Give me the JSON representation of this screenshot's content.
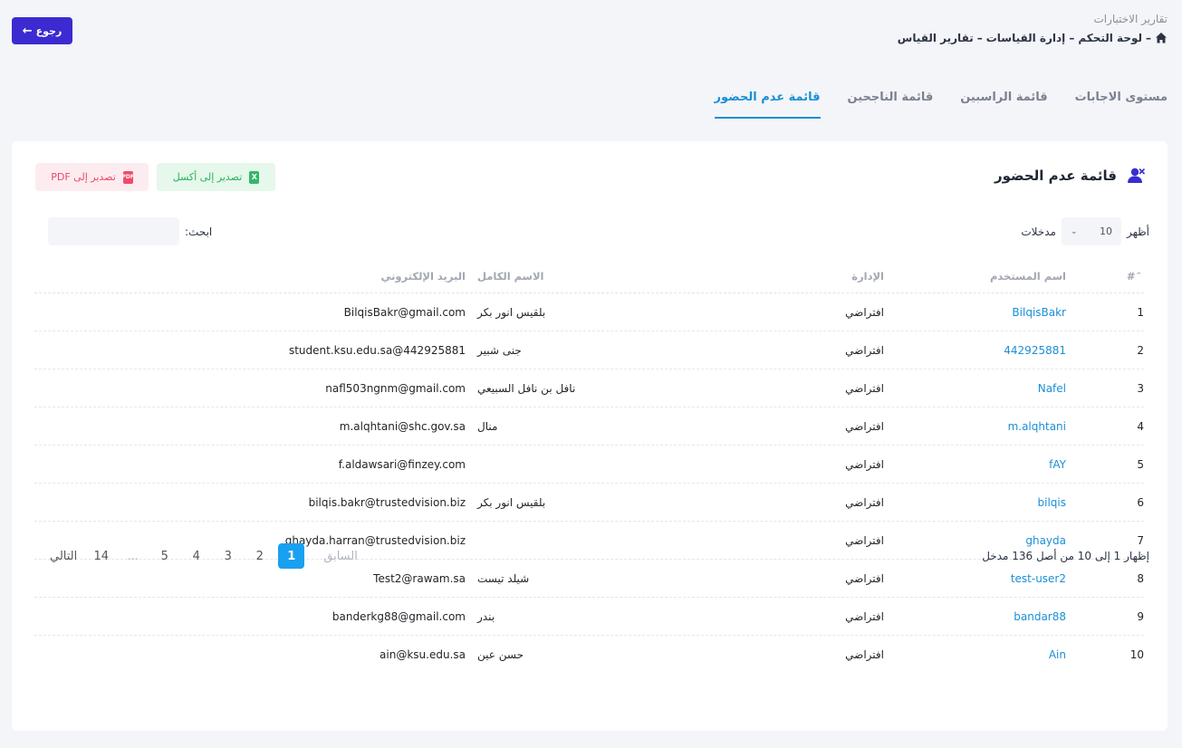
{
  "header": {
    "page_heading": "تقارير الاختبارات",
    "breadcrumb": [
      "لوحة التحكم",
      "إدارة القياسات",
      "تقارير القياس"
    ],
    "back_label": "رجوع"
  },
  "tabs": [
    {
      "label": "قائمة عدم الحضور",
      "active": true
    },
    {
      "label": "قائمة الناجحين",
      "active": false
    },
    {
      "label": "قائمة الراسبين",
      "active": false
    },
    {
      "label": "مستوى الاجابات",
      "active": false
    }
  ],
  "card": {
    "title": "قائمة عدم الحضور",
    "export_excel": "تصدير إلى أكسل",
    "export_pdf": "تصدير إلى PDF",
    "pdf_icon_text": "PDF",
    "excel_icon_text": "X"
  },
  "controls": {
    "show_label": "أظهر",
    "page_size": "10",
    "entries_label": "مدخلات",
    "search_label": "ابحث:",
    "search_value": ""
  },
  "table": {
    "headers": {
      "num": "#",
      "username": "اسم المستخدم",
      "department": "الإدارة",
      "full_name": "الاسم الكامل",
      "email": "البريد الإلكتروني"
    },
    "rows": [
      {
        "num": "1",
        "username": "BilqisBakr",
        "department": "افتراضي",
        "full_name": "بلقيس انور بكر",
        "email": "BilqisBakr@gmail.com"
      },
      {
        "num": "2",
        "username": "442925881",
        "department": "افتراضي",
        "full_name": "جنى شبير",
        "email": "student.ksu.edu.sa@442925881"
      },
      {
        "num": "3",
        "username": "Nafel",
        "department": "افتراضي",
        "full_name": "نافل بن نافل السبيعي",
        "email": "nafl503ngnm@gmail.com"
      },
      {
        "num": "4",
        "username": "m.alqhtani",
        "department": "افتراضي",
        "full_name": "منال",
        "email": "m.alqhtani@shc.gov.sa"
      },
      {
        "num": "5",
        "username": "fAY",
        "department": "افتراضي",
        "full_name": "",
        "email": "f.aldawsari@finzey.com"
      },
      {
        "num": "6",
        "username": "bilqis",
        "department": "افتراضي",
        "full_name": "بلقيس انور بكر",
        "email": "bilqis.bakr@trustedvision.biz"
      },
      {
        "num": "7",
        "username": "ghayda",
        "department": "افتراضي",
        "full_name": "",
        "email": "ghayda.harran@trustedvision.biz"
      },
      {
        "num": "8",
        "username": "test-user2",
        "department": "افتراضي",
        "full_name": "شيلد تيست",
        "email": "Test2@rawam.sa"
      },
      {
        "num": "9",
        "username": "bandar88",
        "department": "افتراضي",
        "full_name": "بندر",
        "email": "banderkg88@gmail.com"
      },
      {
        "num": "10",
        "username": "Ain",
        "department": "افتراضي",
        "full_name": "حسن عين",
        "email": "ain@ksu.edu.sa"
      }
    ]
  },
  "footer": {
    "info": "إظهار 1 إلى 10 من أصل 136 مدخل",
    "prev": "السابق",
    "next": "التالي",
    "pages": [
      "1",
      "2",
      "3",
      "4",
      "5",
      "...",
      "14"
    ],
    "current_page": "1"
  },
  "colors": {
    "accent": "#1a8fd6",
    "back_button": "#3b2bd1",
    "active_page": "#1aa0f0",
    "excel": "#27b457",
    "pdf": "#e8496a"
  }
}
